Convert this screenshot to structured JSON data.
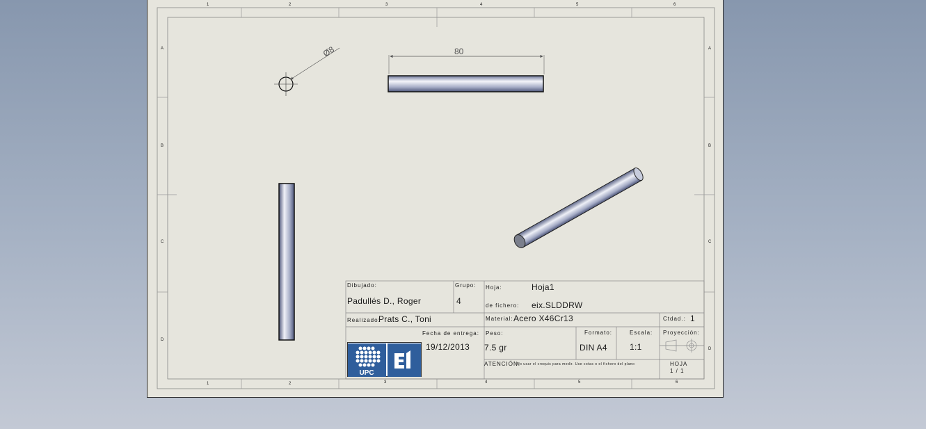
{
  "zones": {
    "columns": [
      "1",
      "2",
      "3",
      "4",
      "5",
      "6"
    ],
    "rows": [
      "A",
      "B",
      "C",
      "D"
    ]
  },
  "dimensions": {
    "diameter": "Ø8",
    "length": "80"
  },
  "title_block": {
    "dibujado_label": "Dibujado:",
    "dibujado_value": "Padullés D., Roger",
    "grupo_label": "Grupo:",
    "grupo_value": "4",
    "hoja_label": "Hoja:",
    "hoja_value": "Hoja1",
    "fichero_label": "de fichero:",
    "fichero_value": "eix.SLDDRW",
    "realizado_label": "Realizado:",
    "realizado_value": "Prats C., Toni",
    "material_label": "Material:",
    "material_value": "Acero X46Cr13",
    "cdad_label": "Ctdad.:",
    "cdad_value": "1",
    "fecha_label": "Fecha de entrega:",
    "fecha_value": "19/12/2013",
    "peso_label": "Peso:",
    "peso_value": "7.5 gr",
    "formato_label": "Formato:",
    "formato_value": "DIN A4",
    "escala_label": "Escala:",
    "escala_value": "1:1",
    "proyeccion_label": "Proyección:",
    "atencion_label": "ATENCIÓN:",
    "atencion_text": "No usar el croquis para medir. Use cotas o el fichero del plano",
    "hoja_num_label": "HOJA",
    "hoja_num_value": "1 / 1",
    "logo_upc_text": "UPC",
    "logo_ei_text": "EI"
  },
  "colors": {
    "sheet": "#e6e5dd",
    "logo_blue": "#2f5e9c",
    "rod_steel": "#9aa3c0"
  }
}
